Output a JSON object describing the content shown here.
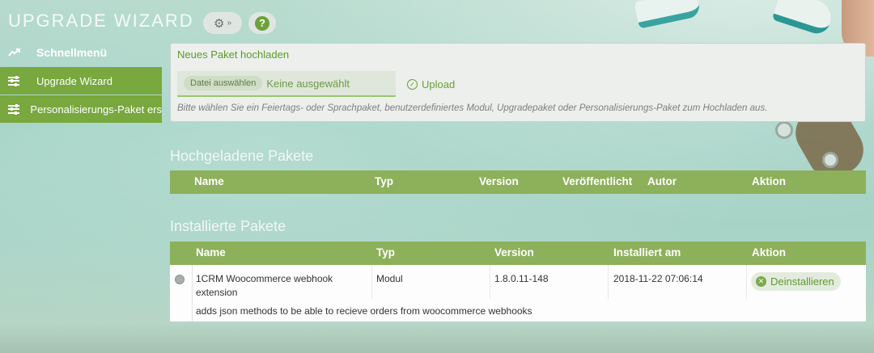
{
  "app": {
    "title": "UPGRADE WIZARD"
  },
  "header": {
    "gear_icon": "gear-icon",
    "help_icon": "help-icon",
    "help_glyph": "?"
  },
  "sidebar": {
    "items": [
      {
        "label": "Schnellmenü",
        "icon": "trend-icon"
      },
      {
        "label": "Upgrade Wizard",
        "icon": "sliders-icon"
      },
      {
        "label": "Personalisierungs-Paket ers",
        "icon": "sliders-icon"
      }
    ]
  },
  "upload": {
    "title": "Neues Paket hochladen",
    "file_button": "Datei auswählen",
    "file_status": "Keine ausgewählt",
    "upload_label": "Upload",
    "hint": "Bitte wählen Sie ein Feiertags- oder Sprachpaket, benutzerdefiniertes Modul, Upgradepaket oder Personalisierungs-Paket zum Hochladen aus."
  },
  "uploaded": {
    "title": "Hochgeladene Pakete",
    "columns": [
      "Name",
      "Typ",
      "Version",
      "Veröffentlicht",
      "Autor",
      "Aktion"
    ]
  },
  "installed": {
    "title": "Installierte Pakete",
    "columns": [
      "Name",
      "Typ",
      "Version",
      "Installiert am",
      "Aktion"
    ],
    "rows": [
      {
        "name": "1CRM Woocommerce webhook extension",
        "type": "Modul",
        "version": "1.8.0.11-148",
        "installed": "2018-11-22 07:06:14",
        "action": "Deinstallieren",
        "description": "adds json methods to be able to recieve orders from woocommerce webhooks"
      }
    ]
  },
  "colors": {
    "accent": "#78a83e",
    "header_green": "#8db05a",
    "link_green": "#6aa032"
  }
}
